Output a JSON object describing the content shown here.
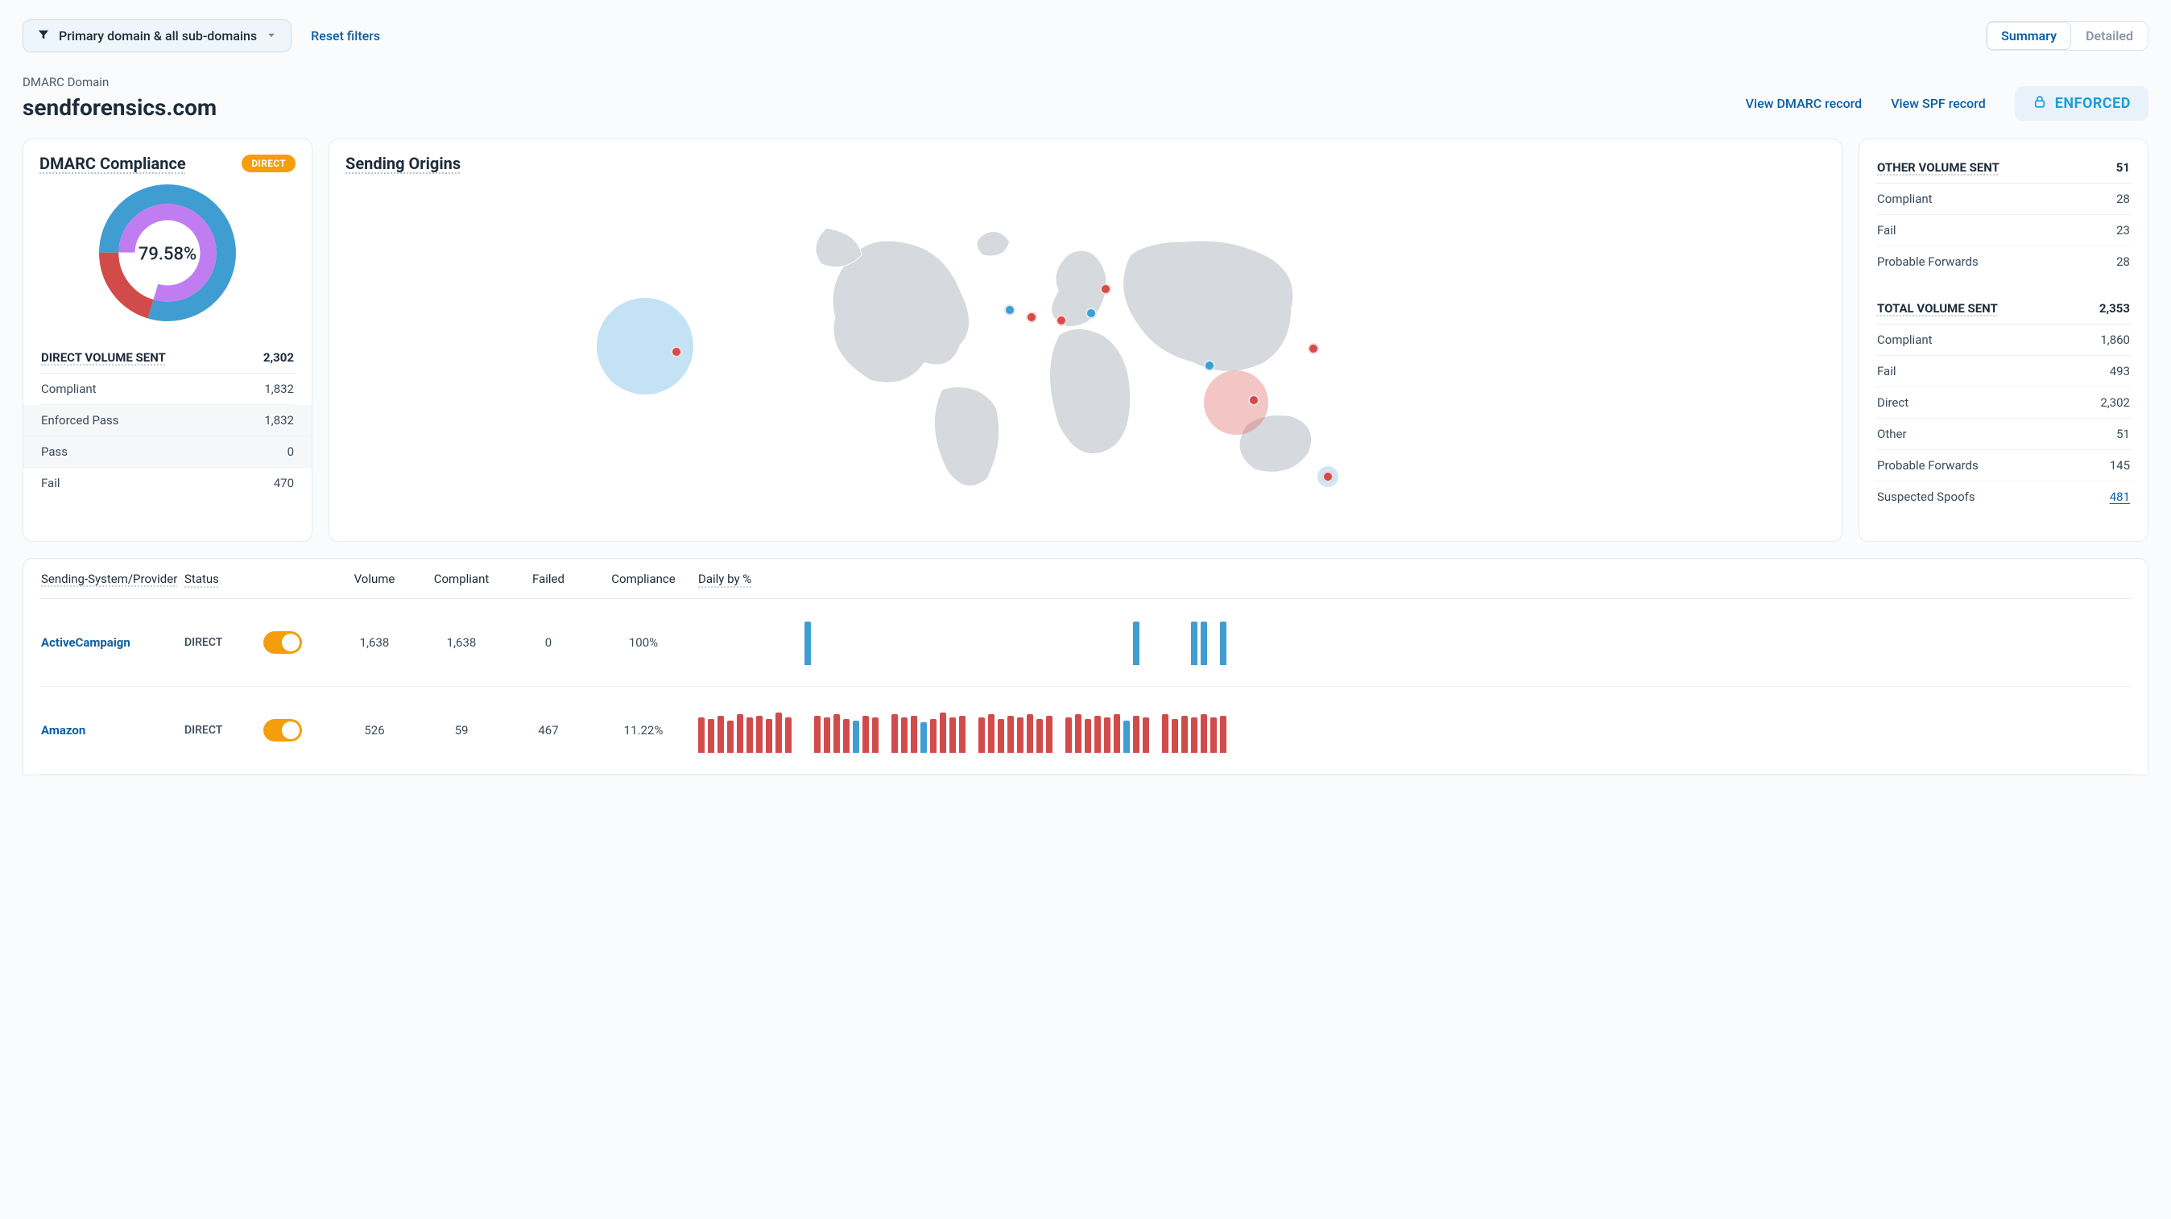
{
  "topbar": {
    "filter_label": "Primary domain & all sub-domains",
    "reset_label": "Reset filters",
    "segments": {
      "summary": "Summary",
      "detailed": "Detailed"
    }
  },
  "header": {
    "domain_label": "DMARC Domain",
    "domain": "sendforensics.com",
    "view_dmarc": "View DMARC record",
    "view_spf": "View SPF record",
    "enforced": "ENFORCED"
  },
  "chart_data": {
    "type": "pie",
    "title": "DMARC Compliance",
    "center_label": "79.58%",
    "series": [
      {
        "name": "Compliant (outer)",
        "value": 79.58,
        "color": "#3f9dd1"
      },
      {
        "name": "Fail (outer)",
        "value": 20.42,
        "color": "#d24b4b"
      },
      {
        "name": "Enforced Pass (inner)",
        "value": 79.58,
        "color": "#c07df2"
      },
      {
        "name": "Pass (inner)",
        "value": 0,
        "color": "#ffffff"
      }
    ]
  },
  "compliance": {
    "title": "DMARC Compliance",
    "badge": "DIRECT",
    "donut_center": "79.58%",
    "direct": {
      "header": "DIRECT VOLUME SENT",
      "total": "2,302",
      "rows": [
        {
          "label": "Compliant",
          "value": "1,832"
        },
        {
          "label": "Enforced Pass",
          "value": "1,832"
        },
        {
          "label": "Pass",
          "value": "0"
        },
        {
          "label": "Fail",
          "value": "470"
        }
      ]
    }
  },
  "origins": {
    "title": "Sending Origins"
  },
  "stats": {
    "other": {
      "header": "OTHER VOLUME SENT",
      "total": "51",
      "rows": [
        {
          "label": "Compliant",
          "value": "28"
        },
        {
          "label": "Fail",
          "value": "23"
        },
        {
          "label": "Probable Forwards",
          "value": "28"
        }
      ]
    },
    "total": {
      "header": "TOTAL VOLUME SENT",
      "total": "2,353",
      "rows": [
        {
          "label": "Compliant",
          "value": "1,860"
        },
        {
          "label": "Fail",
          "value": "493"
        },
        {
          "label": "Direct",
          "value": "2,302"
        },
        {
          "label": "Other",
          "value": "51"
        },
        {
          "label": "Probable Forwards",
          "value": "145"
        },
        {
          "label": "Suspected Spoofs",
          "value": "481",
          "link": true
        }
      ]
    }
  },
  "providers": {
    "cols": {
      "provider": "Sending-System/Provider",
      "status": "Status",
      "volume": "Volume",
      "compliant": "Compliant",
      "failed": "Failed",
      "compliance": "Compliance",
      "daily": "Daily by %"
    },
    "rows": [
      {
        "name": "ActiveCampaign",
        "status": "DIRECT",
        "volume": "1,638",
        "compliant": "1,638",
        "failed": "0",
        "compliance": "100%",
        "spark": [
          {
            "c": "none",
            "h": 2
          },
          {
            "c": "none",
            "h": 2
          },
          {
            "c": "none",
            "h": 2
          },
          {
            "c": "none",
            "h": 2
          },
          {
            "c": "none",
            "h": 2
          },
          {
            "c": "none",
            "h": 2
          },
          {
            "c": "none",
            "h": 2
          },
          {
            "c": "none",
            "h": 2
          },
          {
            "c": "none",
            "h": 2
          },
          {
            "c": "none",
            "h": 2
          },
          {
            "c": "none",
            "h": 2
          },
          {
            "c": "blue",
            "h": 54
          },
          {
            "c": "none",
            "h": 2
          },
          {
            "c": "none",
            "h": 2
          },
          {
            "c": "none",
            "h": 2
          },
          {
            "c": "none",
            "h": 2
          },
          {
            "c": "none",
            "h": 2
          },
          {
            "c": "none",
            "h": 2
          },
          {
            "c": "none",
            "h": 2
          },
          {
            "c": "none",
            "h": 2
          },
          {
            "c": "none",
            "h": 2
          },
          {
            "c": "none",
            "h": 2
          },
          {
            "c": "none",
            "h": 2
          },
          {
            "c": "none",
            "h": 2
          },
          {
            "c": "none",
            "h": 2
          },
          {
            "c": "none",
            "h": 2
          },
          {
            "c": "none",
            "h": 2
          },
          {
            "c": "none",
            "h": 2
          },
          {
            "c": "none",
            "h": 2
          },
          {
            "c": "none",
            "h": 2
          },
          {
            "c": "none",
            "h": 2
          },
          {
            "c": "none",
            "h": 2
          },
          {
            "c": "none",
            "h": 2
          },
          {
            "c": "none",
            "h": 2
          },
          {
            "c": "none",
            "h": 2
          },
          {
            "c": "none",
            "h": 2
          },
          {
            "c": "none",
            "h": 2
          },
          {
            "c": "none",
            "h": 2
          },
          {
            "c": "none",
            "h": 2
          },
          {
            "c": "none",
            "h": 2
          },
          {
            "c": "none",
            "h": 2
          },
          {
            "c": "none",
            "h": 2
          },
          {
            "c": "none",
            "h": 2
          },
          {
            "c": "none",
            "h": 2
          },
          {
            "c": "none",
            "h": 2
          },
          {
            "c": "blue",
            "h": 54
          },
          {
            "c": "none",
            "h": 2
          },
          {
            "c": "none",
            "h": 2
          },
          {
            "c": "none",
            "h": 2
          },
          {
            "c": "none",
            "h": 2
          },
          {
            "c": "none",
            "h": 2
          },
          {
            "c": "blue",
            "h": 54
          },
          {
            "c": "blue",
            "h": 54
          },
          {
            "c": "none",
            "h": 2
          },
          {
            "c": "blue",
            "h": 54
          }
        ]
      },
      {
        "name": "Amazon",
        "status": "DIRECT",
        "volume": "526",
        "compliant": "59",
        "failed": "467",
        "compliance": "11.22%",
        "spark": [
          {
            "c": "red",
            "h": 44
          },
          {
            "c": "red",
            "h": 42
          },
          {
            "c": "red",
            "h": 46
          },
          {
            "c": "red",
            "h": 40
          },
          {
            "c": "red",
            "h": 48
          },
          {
            "c": "red",
            "h": 44
          },
          {
            "c": "red",
            "h": 46
          },
          {
            "c": "red",
            "h": 42
          },
          {
            "c": "red",
            "h": 50
          },
          {
            "c": "red",
            "h": 44
          },
          {
            "c": "none",
            "h": 2
          },
          {
            "c": "none",
            "h": 2
          },
          {
            "c": "red",
            "h": 46
          },
          {
            "c": "red",
            "h": 44
          },
          {
            "c": "red",
            "h": 48
          },
          {
            "c": "red",
            "h": 42
          },
          {
            "c": "blue",
            "h": 40
          },
          {
            "c": "red",
            "h": 46
          },
          {
            "c": "red",
            "h": 44
          },
          {
            "c": "none",
            "h": 2
          },
          {
            "c": "red",
            "h": 48
          },
          {
            "c": "red",
            "h": 44
          },
          {
            "c": "red",
            "h": 46
          },
          {
            "c": "blue",
            "h": 38
          },
          {
            "c": "red",
            "h": 42
          },
          {
            "c": "red",
            "h": 50
          },
          {
            "c": "red",
            "h": 44
          },
          {
            "c": "red",
            "h": 46
          },
          {
            "c": "none",
            "h": 2
          },
          {
            "c": "red",
            "h": 44
          },
          {
            "c": "red",
            "h": 48
          },
          {
            "c": "red",
            "h": 42
          },
          {
            "c": "red",
            "h": 46
          },
          {
            "c": "red",
            "h": 44
          },
          {
            "c": "red",
            "h": 48
          },
          {
            "c": "red",
            "h": 42
          },
          {
            "c": "red",
            "h": 46
          },
          {
            "c": "none",
            "h": 2
          },
          {
            "c": "red",
            "h": 44
          },
          {
            "c": "red",
            "h": 48
          },
          {
            "c": "red",
            "h": 42
          },
          {
            "c": "red",
            "h": 46
          },
          {
            "c": "red",
            "h": 44
          },
          {
            "c": "red",
            "h": 48
          },
          {
            "c": "blue",
            "h": 40
          },
          {
            "c": "red",
            "h": 46
          },
          {
            "c": "red",
            "h": 44
          },
          {
            "c": "none",
            "h": 2
          },
          {
            "c": "red",
            "h": 48
          },
          {
            "c": "red",
            "h": 42
          },
          {
            "c": "red",
            "h": 46
          },
          {
            "c": "red",
            "h": 44
          },
          {
            "c": "red",
            "h": 48
          },
          {
            "c": "red",
            "h": 44
          },
          {
            "c": "red",
            "h": 46
          }
        ]
      }
    ]
  }
}
